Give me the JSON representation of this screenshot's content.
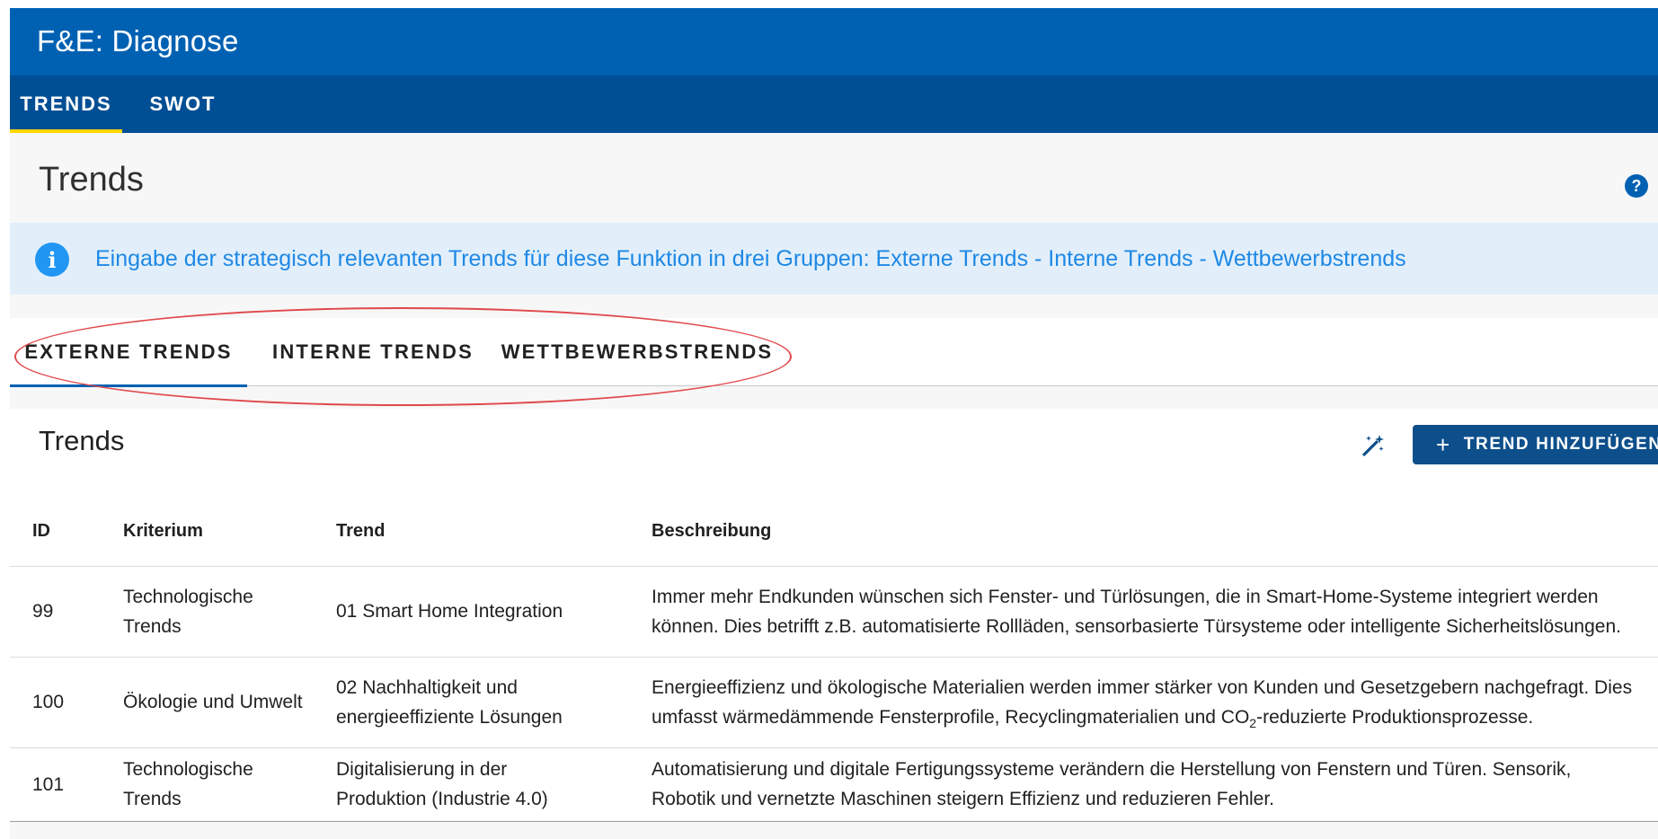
{
  "app": {
    "title": "F&E: Diagnose"
  },
  "nav": {
    "tabs": [
      {
        "label": "TRENDS",
        "active": true
      },
      {
        "label": "SWOT",
        "active": false
      }
    ]
  },
  "page": {
    "title": "Trends",
    "help_icon": "question-circle-icon"
  },
  "info": {
    "icon": "info-circle-icon",
    "text": "Eingabe der strategisch relevanten Trends für diese Funktion in drei Gruppen: Externe Trends - Interne Trends - Wettbewerbstrends"
  },
  "tabs": [
    {
      "label": "EXTERNE TRENDS",
      "active": true
    },
    {
      "label": "INTERNE TRENDS",
      "active": false
    },
    {
      "label": "WETTBEWERBSTRENDS",
      "active": false
    }
  ],
  "table_card": {
    "title": "Trends",
    "wand_icon": "magic-wand-icon",
    "add_button": "TREND HINZUFÜGEN",
    "columns": {
      "id": "ID",
      "kriterium": "Kriterium",
      "trend": "Trend",
      "beschreibung": "Beschreibung"
    },
    "rows": [
      {
        "id": "99",
        "kriterium": "Technologische Trends",
        "trend": "01 Smart Home Integration",
        "beschreibung": "Immer mehr Endkunden wünschen sich Fenster- und Türlösungen, die in Smart-Home-Systeme integriert werden können. Dies betrifft z.B. automatisierte Rollläden, sensorbasierte Türsysteme oder intelligente Sicherheitslösungen."
      },
      {
        "id": "100",
        "kriterium": "Ökologie und Umwelt",
        "trend": "02 Nachhaltigkeit und energieeffiziente Lösungen",
        "beschreibung_pre": "Energieeffizienz und ökologische Materialien werden immer stärker von Kunden und Gesetzgebern nachgefragt. Dies umfasst wärmedämmende Fensterprofile, Recyclingmaterialien und CO",
        "beschreibung_sub": "2",
        "beschreibung_post": "-reduzierte Produktionsprozesse."
      },
      {
        "id": "101",
        "kriterium": "Technologische Trends",
        "trend": "Digitalisierung in der Produktion (Industrie 4.0)",
        "beschreibung": "Automatisierung und digitale Fertigungssysteme verändern die Herstellung von Fenstern und Türen. Sensorik, Robotik und vernetzte Maschinen steigern Effizienz und reduzieren Fehler."
      }
    ]
  },
  "colors": {
    "appbar": "#0061b3",
    "navbar": "#004f94",
    "nav_indicator": "#ffd600",
    "info_bg": "#e2effa",
    "info_text": "#1e88e5",
    "button": "#0d4f8b",
    "annotation": "#e0484b"
  }
}
